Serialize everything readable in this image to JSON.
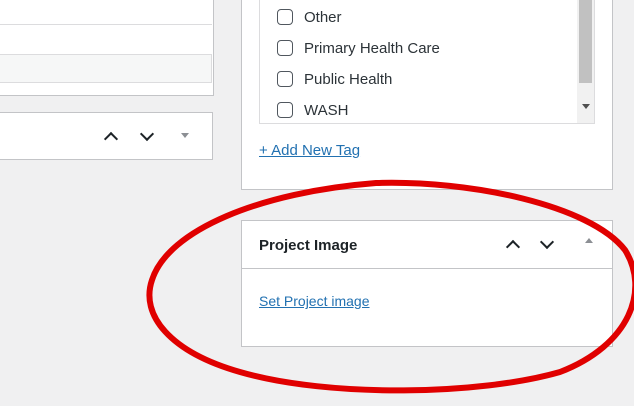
{
  "tags_panel": {
    "items": [
      {
        "label": "Other"
      },
      {
        "label": "Primary Health Care"
      },
      {
        "label": "Public Health"
      },
      {
        "label": "WASH"
      }
    ],
    "add_new_tag": "+ Add New Tag"
  },
  "project_image_panel": {
    "title": "Project Image",
    "set_link": "Set Project image"
  },
  "icons": {
    "move_up": "chevron-up-icon",
    "move_down": "chevron-down-icon",
    "toggle_panel": "triangle-toggle-icon"
  },
  "colors": {
    "link": "#2271b1",
    "annotation": "#e00000",
    "background": "#f0f0f1"
  }
}
